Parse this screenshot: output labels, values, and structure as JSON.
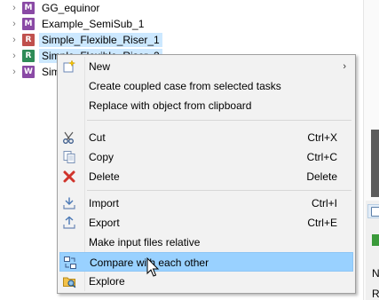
{
  "tree": {
    "items": [
      {
        "label": "GG_equinor",
        "icon": "model-icon",
        "icon_color": "#8a4aa5",
        "icon_letter": "M",
        "selected": false
      },
      {
        "label": "Example_SemiSub_1",
        "icon": "model-icon",
        "icon_color": "#8a4aa5",
        "icon_letter": "M",
        "selected": false
      },
      {
        "label": "Simple_Flexible_Riser_1",
        "icon": "riser-icon",
        "icon_color": "#c0504d",
        "icon_letter": "R",
        "selected": true
      },
      {
        "label": "Simple_Flexible_Riser_2",
        "icon": "riser-icon",
        "icon_color": "#2e8b57",
        "icon_letter": "R",
        "selected": true
      },
      {
        "label": "Sim",
        "icon": "result-icon",
        "icon_color": "#8a4aa5",
        "icon_letter": "W",
        "selected": false
      }
    ]
  },
  "menu": {
    "items": [
      {
        "id": "new",
        "label": "New",
        "shortcut": "",
        "submenu": true,
        "icon": "new-icon"
      },
      {
        "id": "create-coupled",
        "label": "Create coupled case from selected tasks",
        "shortcut": "",
        "icon": ""
      },
      {
        "id": "replace",
        "label": "Replace with object from clipboard",
        "shortcut": "",
        "icon": ""
      },
      {
        "id": "cut",
        "label": "Cut",
        "shortcut": "Ctrl+X",
        "icon": "scissors-icon"
      },
      {
        "id": "copy",
        "label": "Copy",
        "shortcut": "Ctrl+C",
        "icon": "copy-icon"
      },
      {
        "id": "delete",
        "label": "Delete",
        "shortcut": "Delete",
        "icon": "delete-icon"
      },
      {
        "id": "import",
        "label": "Import",
        "shortcut": "Ctrl+I",
        "icon": "import-icon"
      },
      {
        "id": "export",
        "label": "Export",
        "shortcut": "Ctrl+E",
        "icon": "export-icon"
      },
      {
        "id": "relative",
        "label": "Make input files relative",
        "shortcut": "",
        "icon": ""
      },
      {
        "id": "compare",
        "label": "Compare with each other",
        "shortcut": "",
        "icon": "compare-icon",
        "hover": true
      },
      {
        "id": "explore",
        "label": "Explore",
        "shortcut": "",
        "icon": "explore-icon"
      }
    ]
  },
  "right_edge": {
    "frag1": "N",
    "frag2": "R"
  },
  "colors": {
    "selection": "#cce8ff",
    "menu_hover": "#99d1ff",
    "menu_bg": "#f2f2f2"
  }
}
